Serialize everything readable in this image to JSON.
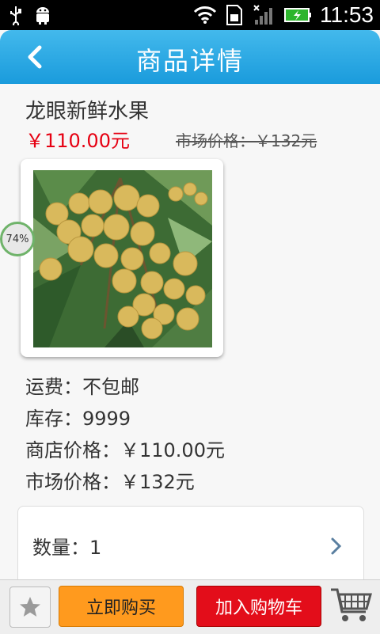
{
  "status_bar": {
    "time": "11:53",
    "icons": [
      "usb-icon",
      "android-debug-icon",
      "wifi-icon",
      "sim-icon",
      "signal-icon",
      "battery-charging-icon"
    ]
  },
  "header": {
    "title": "商品详情",
    "back_icon": "chevron-left-icon"
  },
  "product": {
    "name": "龙眼新鲜水果",
    "shop_price": "￥110.00元",
    "market_price_strike": "市场价格：￥132元",
    "image_icon": "longan-fruit-image",
    "shipping": "运费：不包邮",
    "stock": "库存：9999",
    "shop_price_line": "商店价格：￥110.00元",
    "market_price_line": "市场价格：￥132元"
  },
  "progress_badge": "74%",
  "quantity": {
    "label": "数量：1"
  },
  "bottom_bar": {
    "favorite_icon": "star-icon",
    "buy_now": "立即购买",
    "add_to_cart": "加入购物车",
    "cart_icon": "shopping-cart-icon"
  },
  "colors": {
    "header_blue": "#1a9bdc",
    "price_red": "#e60012",
    "buy_orange": "#ff9a1e",
    "cart_red": "#e30d1a"
  }
}
